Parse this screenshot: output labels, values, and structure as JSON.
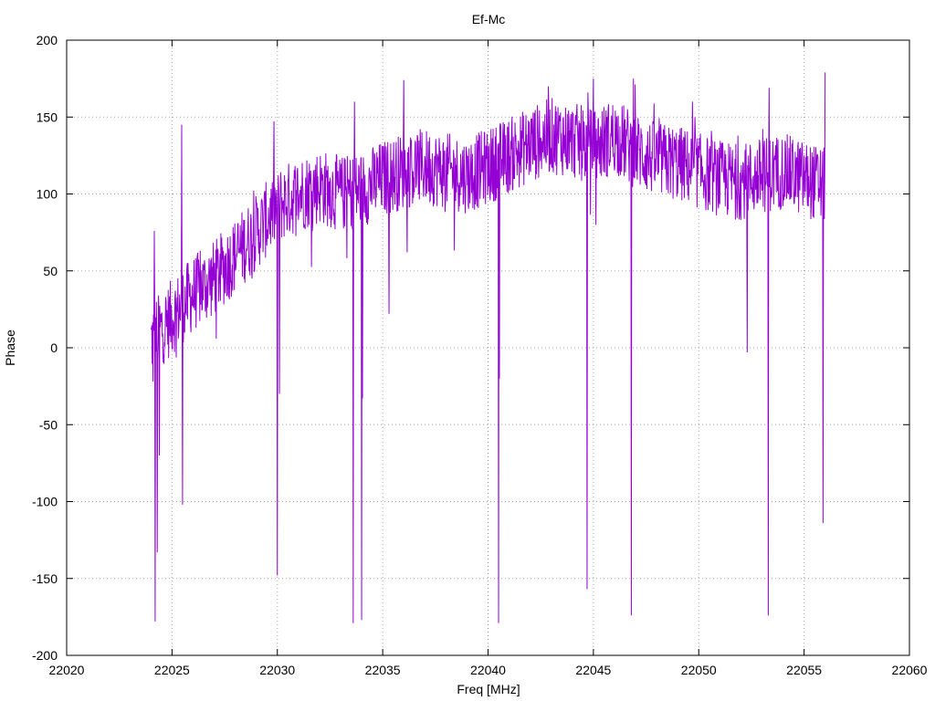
{
  "chart_data": {
    "type": "line",
    "title": "Ef-Mc",
    "xlabel": "Freq [MHz]",
    "ylabel": "Phase",
    "xlim": [
      22020,
      22060
    ],
    "ylim": [
      -200,
      200
    ],
    "xticks": [
      22020,
      22025,
      22030,
      22035,
      22040,
      22045,
      22050,
      22055,
      22060
    ],
    "yticks": [
      -200,
      -150,
      -100,
      -50,
      0,
      50,
      100,
      150,
      200
    ],
    "grid": true,
    "legend": "none",
    "series_color": "#9400d3",
    "x_range_of_data": [
      22024.0,
      22056.0
    ],
    "trend_points": [
      {
        "x": 22024.0,
        "y": 5
      },
      {
        "x": 22025.0,
        "y": 20
      },
      {
        "x": 22026.0,
        "y": 35
      },
      {
        "x": 22027.0,
        "y": 45
      },
      {
        "x": 22028.0,
        "y": 60
      },
      {
        "x": 22029.0,
        "y": 75
      },
      {
        "x": 22030.0,
        "y": 92
      },
      {
        "x": 22031.0,
        "y": 100
      },
      {
        "x": 22032.0,
        "y": 105
      },
      {
        "x": 22033.0,
        "y": 100
      },
      {
        "x": 22034.0,
        "y": 103
      },
      {
        "x": 22035.0,
        "y": 110
      },
      {
        "x": 22036.0,
        "y": 115
      },
      {
        "x": 22037.0,
        "y": 118
      },
      {
        "x": 22038.0,
        "y": 115
      },
      {
        "x": 22039.0,
        "y": 112
      },
      {
        "x": 22040.0,
        "y": 118
      },
      {
        "x": 22041.0,
        "y": 125
      },
      {
        "x": 22042.0,
        "y": 132
      },
      {
        "x": 22043.0,
        "y": 138
      },
      {
        "x": 22044.0,
        "y": 135
      },
      {
        "x": 22045.0,
        "y": 130
      },
      {
        "x": 22046.0,
        "y": 138
      },
      {
        "x": 22047.0,
        "y": 128
      },
      {
        "x": 22048.0,
        "y": 122
      },
      {
        "x": 22049.0,
        "y": 120
      },
      {
        "x": 22050.0,
        "y": 115
      },
      {
        "x": 22051.0,
        "y": 110
      },
      {
        "x": 22052.0,
        "y": 108
      },
      {
        "x": 22053.0,
        "y": 112
      },
      {
        "x": 22054.0,
        "y": 115
      },
      {
        "x": 22055.0,
        "y": 110
      },
      {
        "x": 22056.0,
        "y": 105
      }
    ],
    "noise_amplitude": 25,
    "spikes": [
      {
        "x": 22024.1,
        "y": -22
      },
      {
        "x": 22024.15,
        "y": 76
      },
      {
        "x": 22024.2,
        "y": -178
      },
      {
        "x": 22024.3,
        "y": -133
      },
      {
        "x": 22024.4,
        "y": -70
      },
      {
        "x": 22025.45,
        "y": 145
      },
      {
        "x": 22025.5,
        "y": -102
      },
      {
        "x": 22030.0,
        "y": -148
      },
      {
        "x": 22030.1,
        "y": -30
      },
      {
        "x": 22033.6,
        "y": -179
      },
      {
        "x": 22033.65,
        "y": 160
      },
      {
        "x": 22034.0,
        "y": -177
      },
      {
        "x": 22034.05,
        "y": -33
      },
      {
        "x": 22035.3,
        "y": 22
      },
      {
        "x": 22036.0,
        "y": 174
      },
      {
        "x": 22040.5,
        "y": -179
      },
      {
        "x": 22040.55,
        "y": -20
      },
      {
        "x": 22044.7,
        "y": -157
      },
      {
        "x": 22044.75,
        "y": 166
      },
      {
        "x": 22045.0,
        "y": 175
      },
      {
        "x": 22046.8,
        "y": -174
      },
      {
        "x": 22046.9,
        "y": 175
      },
      {
        "x": 22052.3,
        "y": -3
      },
      {
        "x": 22053.3,
        "y": -174
      },
      {
        "x": 22053.35,
        "y": 169
      },
      {
        "x": 22055.9,
        "y": -114
      },
      {
        "x": 22056.0,
        "y": 179
      }
    ]
  }
}
